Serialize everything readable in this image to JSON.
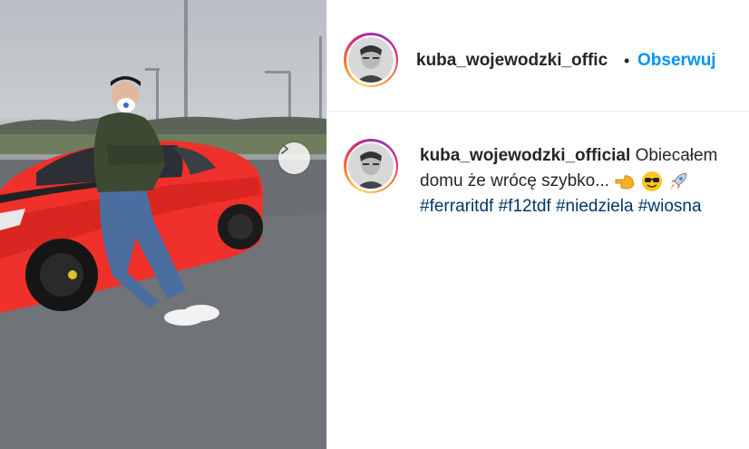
{
  "post": {
    "username_header": "kuba_wojewodzki_offic",
    "separator": "•",
    "follow_label": "Obserwuj",
    "caption_username": "kuba_wojewodzki_official",
    "caption_line1": "Obiecałem",
    "caption_line2": "domu że wrócę szybko...",
    "hashtags": [
      "#ferraritdf",
      "#f12tdf",
      "#niedziela",
      "#wiosna"
    ],
    "emojis": [
      "pointing-left-hand-icon",
      "sunglasses-face-icon",
      "rocket-icon"
    ]
  },
  "colors": {
    "accent_blue": "#0095f6",
    "hashtag_blue": "#00376b",
    "text": "#262626",
    "car_red": "#f0302a"
  }
}
